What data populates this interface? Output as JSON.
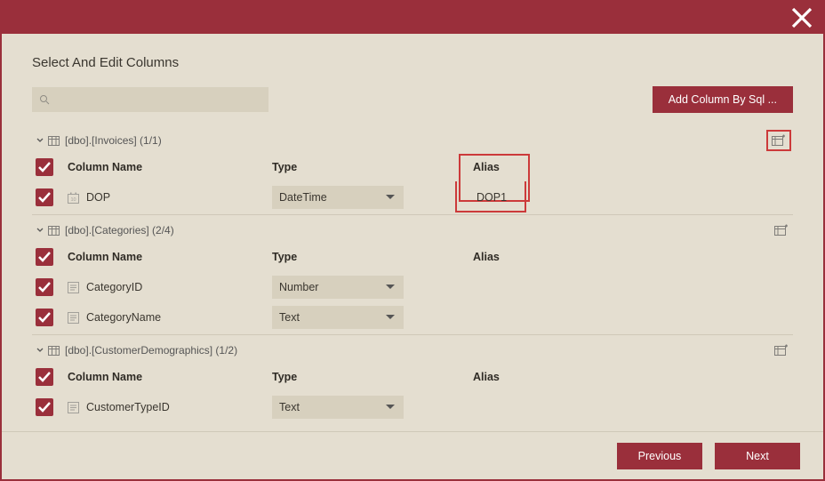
{
  "title": "Select And Edit Columns",
  "buttons": {
    "addSql": "Add Column By Sql ...",
    "prev": "Previous",
    "next": "Next"
  },
  "headers": {
    "col": "Column Name",
    "type": "Type",
    "alias": "Alias"
  },
  "emptyAlias": "<Empty>",
  "groups": [
    {
      "label": "[dbo].[Invoices]  (1/1)",
      "highlightAction": true,
      "highlightAlias": true,
      "rows": [
        {
          "name": "DOP",
          "iconText": "10",
          "type": "DateTime",
          "alias": "DOP1",
          "aliasEmpty": false
        }
      ]
    },
    {
      "label": "[dbo].[Categories]  (2/4)",
      "highlightAction": false,
      "highlightAlias": false,
      "rows": [
        {
          "name": "CategoryID",
          "iconText": "",
          "type": "Number",
          "alias": "<Empty>",
          "aliasEmpty": true
        },
        {
          "name": "CategoryName",
          "iconText": "",
          "type": "Text",
          "alias": "<Empty>",
          "aliasEmpty": true
        }
      ]
    },
    {
      "label": "[dbo].[CustomerDemographics]  (1/2)",
      "highlightAction": false,
      "highlightAlias": false,
      "rows": [
        {
          "name": "CustomerTypeID",
          "iconText": "",
          "type": "Text",
          "alias": "<Empty>",
          "aliasEmpty": true
        }
      ]
    }
  ]
}
